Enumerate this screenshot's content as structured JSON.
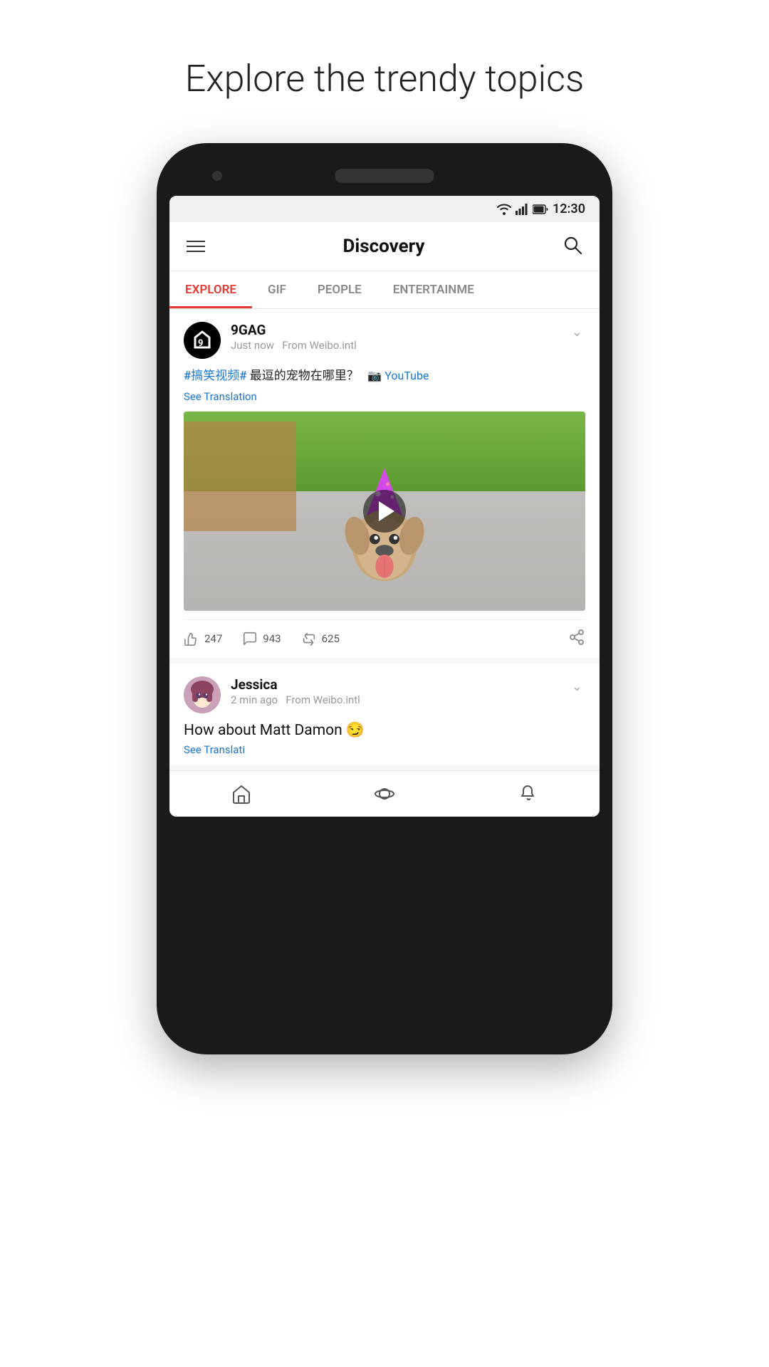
{
  "page": {
    "title": "Explore the trendy topics"
  },
  "status_bar": {
    "time": "12:30"
  },
  "nav": {
    "title": "Discovery",
    "hamburger_label": "menu",
    "search_label": "search"
  },
  "tabs": [
    {
      "id": "explore",
      "label": "EXPLORE",
      "active": true
    },
    {
      "id": "gif",
      "label": "GIF",
      "active": false
    },
    {
      "id": "people",
      "label": "PEOPLE",
      "active": false
    },
    {
      "id": "entertainment",
      "label": "ENTERTAINME",
      "active": false
    }
  ],
  "posts": [
    {
      "id": "post-1",
      "author": "9GAG",
      "timestamp": "Just now",
      "source": "From Weibo.intl",
      "hashtag": "#搞笑视频#",
      "text_after_hashtag": " 最逗的宠物在哪里？",
      "youtube_label": "YouTube",
      "see_translation": "See Translation",
      "likes": "247",
      "comments": "943",
      "shares": "625"
    },
    {
      "id": "post-2",
      "author": "Jessica",
      "timestamp": "2 min ago",
      "source": "From Weibo.intl",
      "text": "How about Matt Damon 😏",
      "see_translation": "See Translati"
    }
  ],
  "bottom_nav": [
    {
      "id": "home",
      "icon": "home",
      "label": "Home"
    },
    {
      "id": "discover",
      "icon": "discover",
      "label": "Discover"
    },
    {
      "id": "notifications",
      "icon": "notifications",
      "label": "Notifications"
    }
  ],
  "colors": {
    "active_tab": "#e53935",
    "hashtag": "#1976d2",
    "youtube_link": "#1976d2",
    "action_icon": "#888888",
    "bottom_nav_icon": "#555555"
  }
}
